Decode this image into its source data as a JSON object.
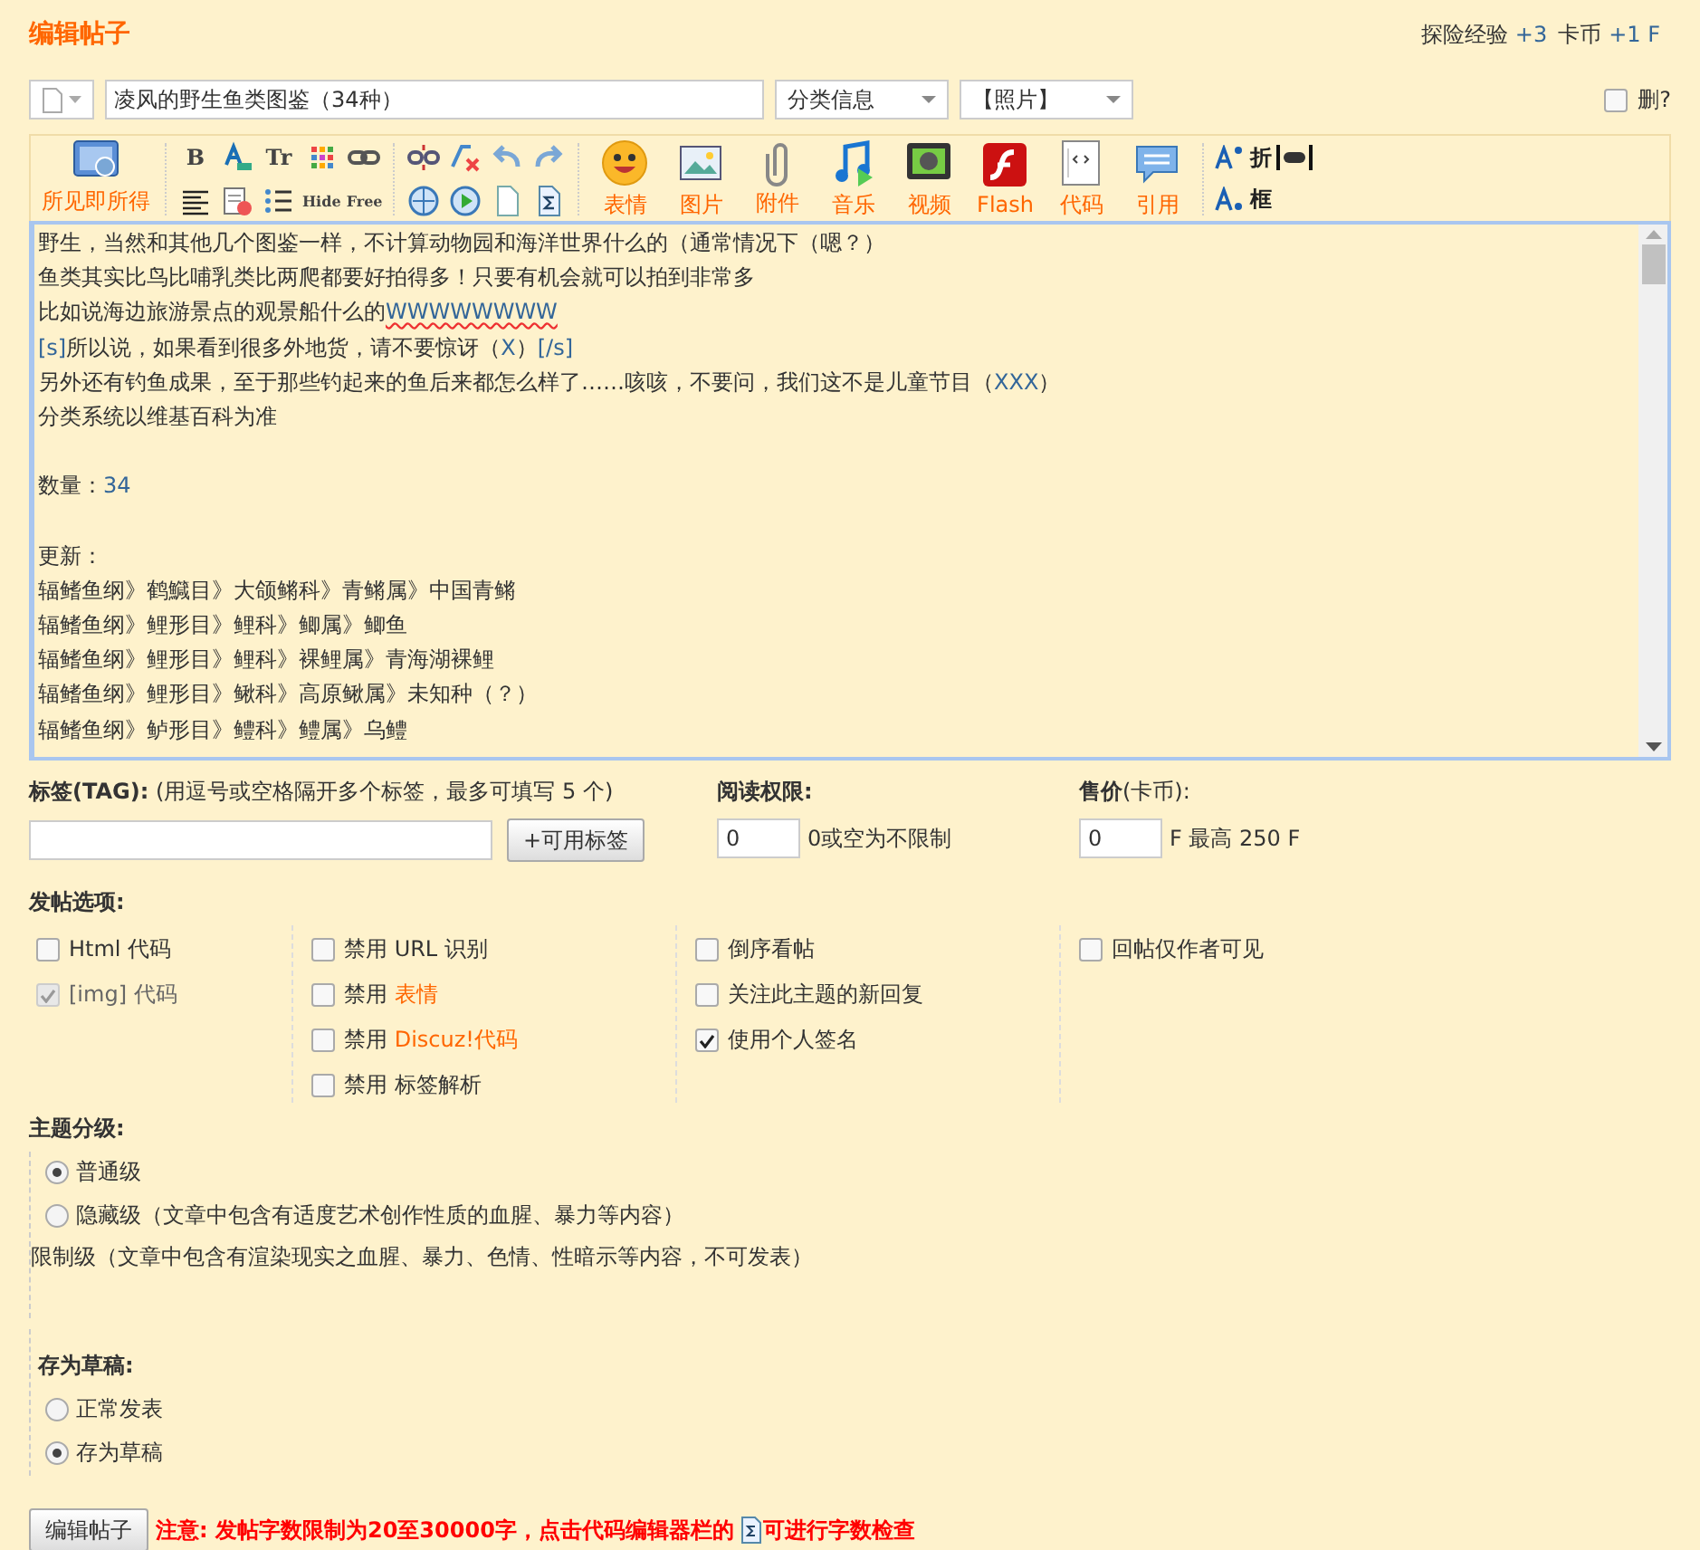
{
  "header": {
    "title": "编辑帖子",
    "exp_label": "探险经验",
    "exp_value": "+3",
    "coin_label": "卡币",
    "coin_value": "+1 F"
  },
  "title_row": {
    "subject": "凌风的野生鱼类图鉴（34种）",
    "category": "分类信息",
    "type": "【照片】",
    "delete_label": "删?",
    "delete_checked": false
  },
  "toolbar": {
    "wysiwyg": "所见即所得",
    "small_top": [
      {
        "kind": "glyph",
        "text": "B"
      },
      {
        "kind": "fontcolor"
      },
      {
        "kind": "glyph",
        "text": "Tr"
      },
      {
        "kind": "grid"
      },
      {
        "kind": "link"
      },
      {
        "kind": "unlink"
      },
      {
        "kind": "clear"
      },
      {
        "kind": "undo"
      },
      {
        "kind": "redo"
      }
    ],
    "small_bottom": [
      {
        "kind": "align"
      },
      {
        "kind": "paste"
      },
      {
        "kind": "list"
      },
      {
        "kind": "glyph",
        "text": "Hide"
      },
      {
        "kind": "glyph",
        "text": "Free"
      },
      {
        "kind": "globe"
      },
      {
        "kind": "play"
      },
      {
        "kind": "page"
      },
      {
        "kind": "sigma"
      }
    ],
    "big": [
      {
        "kind": "smile",
        "label": "表情"
      },
      {
        "kind": "image",
        "label": "图片"
      },
      {
        "kind": "clip",
        "label": "附件"
      },
      {
        "kind": "music",
        "label": "音乐"
      },
      {
        "kind": "tv",
        "label": "视频"
      },
      {
        "kind": "flash",
        "label": "Flash"
      },
      {
        "kind": "code",
        "label": "代码"
      },
      {
        "kind": "quote",
        "label": "引用"
      }
    ],
    "extra": [
      {
        "kind": "sup",
        "text": "折"
      },
      {
        "kind": "sub",
        "text": "框"
      }
    ]
  },
  "editor": {
    "lines": [
      {
        "kind": "text",
        "segments": [
          {
            "kind": "plain",
            "text": "野生，当然和其他几个图鉴一样，不计算动物园和海洋世界什么的（通常情况下（嗯？）"
          }
        ]
      },
      {
        "kind": "text",
        "segments": [
          {
            "kind": "plain",
            "text": "鱼类其实比鸟比哺乳类比两爬都要好拍得多！只要有机会就可以拍到非常多"
          }
        ]
      },
      {
        "kind": "text",
        "segments": [
          {
            "kind": "plain",
            "text": "比如说海边旅游景点的观景船什么的"
          },
          {
            "kind": "spell",
            "text": "WWWWWWWW"
          }
        ]
      },
      {
        "kind": "text",
        "segments": [
          {
            "kind": "tag",
            "text": "[s]"
          },
          {
            "kind": "plain",
            "text": "所以说，如果看到很多外地货，请不要惊讶（"
          },
          {
            "kind": "tag",
            "text": "X"
          },
          {
            "kind": "plain",
            "text": "）"
          },
          {
            "kind": "tag",
            "text": "[/s]"
          }
        ]
      },
      {
        "kind": "text",
        "segments": [
          {
            "kind": "plain",
            "text": "另外还有钓鱼成果，至于那些钓起来的鱼后来都怎么样了……咳咳，不要问，我们这不是儿童节目（"
          },
          {
            "kind": "tag",
            "text": "XXX"
          },
          {
            "kind": "plain",
            "text": "）"
          }
        ]
      },
      {
        "kind": "text",
        "segments": [
          {
            "kind": "plain",
            "text": "分类系统以维基百科为准"
          }
        ]
      },
      {
        "kind": "blank"
      },
      {
        "kind": "text",
        "segments": [
          {
            "kind": "plain",
            "text": "数量："
          },
          {
            "kind": "tag",
            "text": "34"
          }
        ]
      },
      {
        "kind": "blank"
      },
      {
        "kind": "text",
        "segments": [
          {
            "kind": "plain",
            "text": "更新："
          }
        ]
      },
      {
        "kind": "text",
        "segments": [
          {
            "kind": "plain",
            "text": "辐鳍鱼纲》鹤鱵目》大颌鳉科》青鳉属》中国青鳉"
          }
        ]
      },
      {
        "kind": "text",
        "segments": [
          {
            "kind": "plain",
            "text": "辐鳍鱼纲》鲤形目》鲤科》鲫属》鲫鱼"
          }
        ]
      },
      {
        "kind": "text",
        "segments": [
          {
            "kind": "plain",
            "text": "辐鳍鱼纲》鲤形目》鲤科》裸鲤属》青海湖裸鲤"
          }
        ]
      },
      {
        "kind": "text",
        "segments": [
          {
            "kind": "plain",
            "text": "辐鳍鱼纲》鲤形目》鳅科》高原鳅属》未知种（？）"
          }
        ]
      },
      {
        "kind": "text",
        "segments": [
          {
            "kind": "plain",
            "text": "辐鳍鱼纲》鲈形目》鳢科》鳢属》乌鳢"
          }
        ]
      }
    ]
  },
  "tags": {
    "label": "标签(TAG):",
    "hint": "(用逗号或空格隔开多个标签，最多可填写 5 个)",
    "button": "+可用标签"
  },
  "read_perm": {
    "label": "阅读权限:",
    "value": "0",
    "note": "0或空为不限制"
  },
  "price": {
    "label": "售价",
    "unit": "(卡币):",
    "value": "0",
    "note": "F 最高 250 F"
  },
  "options": {
    "label": "发帖选项:",
    "columns": [
      [
        {
          "text": "Html 代码",
          "checked": false
        },
        {
          "text": "[img] 代码",
          "checked": true,
          "disabled": true
        }
      ],
      [
        {
          "text": "禁用 URL 识别",
          "checked": false
        },
        {
          "text": "禁用 ",
          "link": "表情",
          "checked": false
        },
        {
          "text": "禁用 ",
          "link": "Discuz!代码",
          "checked": false
        },
        {
          "text": "禁用 标签解析",
          "checked": false
        }
      ],
      [
        {
          "text": "倒序看帖",
          "checked": false
        },
        {
          "text": "关注此主题的新回复",
          "checked": false
        },
        {
          "text": "使用个人签名",
          "checked": true
        }
      ],
      [
        {
          "text": "回帖仅作者可见",
          "checked": false
        }
      ]
    ]
  },
  "grading": {
    "label": "主题分级:",
    "items": [
      {
        "kind": "radio",
        "text": "普通级",
        "selected": true
      },
      {
        "kind": "radio",
        "text": "隐藏级（文章中包含有适度艺术创作性质的血腥、暴力等内容）",
        "selected": false
      },
      {
        "kind": "note",
        "text": "限制级（文章中包含有渲染现实之血腥、暴力、色情、性暗示等内容，不可发表）"
      }
    ]
  },
  "draft": {
    "label": "存为草稿:",
    "items": [
      {
        "text": "正常发表",
        "selected": false
      },
      {
        "text": "存为草稿",
        "selected": true
      }
    ]
  },
  "footer": {
    "button": "编辑帖子",
    "notice_before": "注意: 发帖字数限制为20至30000字，点击代码编辑器栏的",
    "notice_after": "可进行字数检查"
  }
}
